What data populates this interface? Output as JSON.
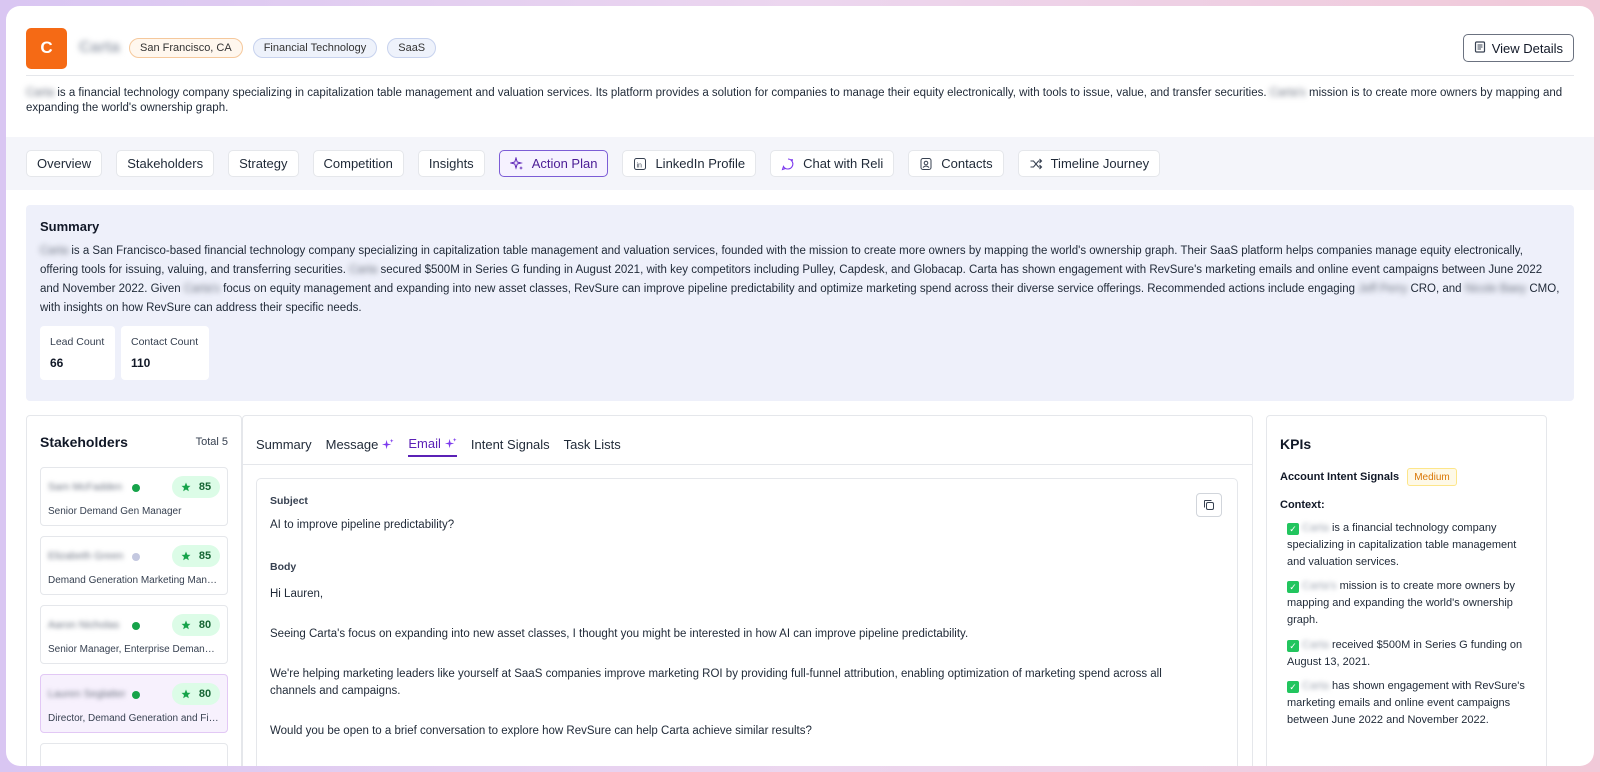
{
  "company": {
    "logo_letter": "C",
    "name": "Carta",
    "tags": [
      "San Francisco, CA",
      "Financial Technology",
      "SaaS"
    ],
    "view_details": "View Details",
    "description_name": "Carta",
    "description_a": "is a financial technology company specializing in capitalization table management and valuation services. Its platform provides a solution for companies to manage their equity electronically, with tools to issue, value, and transfer securities.",
    "description_name2": "Carta's",
    "description_b": "mission is to create more owners by mapping and expanding the world's ownership graph."
  },
  "tabs": [
    {
      "label": "Overview",
      "icon": ""
    },
    {
      "label": "Stakeholders",
      "icon": ""
    },
    {
      "label": "Strategy",
      "icon": ""
    },
    {
      "label": "Competition",
      "icon": ""
    },
    {
      "label": "Insights",
      "icon": ""
    },
    {
      "label": "Action Plan",
      "icon": "sparkle-icon"
    },
    {
      "label": "LinkedIn Profile",
      "icon": "linkedin-icon"
    },
    {
      "label": "Chat with Reli",
      "icon": "chat-icon"
    },
    {
      "label": "Contacts",
      "icon": "contacts-icon"
    },
    {
      "label": "Timeline Journey",
      "icon": "shuffle-icon"
    }
  ],
  "summary": {
    "title": "Summary",
    "p1_name": "Carta",
    "p1": "is a San Francisco-based financial technology company specializing in capitalization table management and valuation services, founded with the mission to create more owners by mapping the world's ownership graph. Their SaaS platform helps companies manage equity electronically, offering tools for issuing, valuing, and transferring securities.",
    "p2_name": "Carta",
    "p2": "secured $500M in Series G funding in August 2021, with key competitors including Pulley, Capdesk, and Globacap. Carta has shown engagement with RevSure's marketing emails and online event campaigns between June 2022 and November 2022. Given",
    "p3_name": "Carta's",
    "p3": "focus on equity management and expanding into new asset classes, RevSure can improve pipeline predictability and optimize marketing spend across their diverse service offerings. Recommended actions include engaging",
    "p4_name": "Jeff Perry",
    "p4": "CRO, and",
    "p5_name": "Nicole Baey",
    "p5": "CMO, with insights on how RevSure can address their specific needs.",
    "lead_label": "Lead Count",
    "lead_value": "66",
    "contact_label": "Contact Count",
    "contact_value": "110"
  },
  "stakeholders": {
    "title": "Stakeholders",
    "total": "Total 5",
    "items": [
      {
        "name": "Sam McFadden",
        "role": "Senior Demand Gen Manager",
        "score": "85",
        "dot": "#16a34a"
      },
      {
        "name": "Elizabeth Green",
        "role": "Demand Generation Marketing Manager",
        "score": "85",
        "dot": "#c4c8e0"
      },
      {
        "name": "Aaron Nicholas",
        "role": "Senior Manager, Enterprise Demand Generation",
        "score": "80",
        "dot": "#16a34a"
      },
      {
        "name": "Lauren Seglatter",
        "role": "Director, Demand Generation and Field Marketing",
        "score": "80",
        "dot": "#16a34a"
      }
    ]
  },
  "action": {
    "subtabs": [
      {
        "label": "Summary",
        "sparkle": false
      },
      {
        "label": "Message",
        "sparkle": true
      },
      {
        "label": "Email",
        "sparkle": true
      },
      {
        "label": "Intent Signals",
        "sparkle": false
      },
      {
        "label": "Task Lists",
        "sparkle": false
      }
    ],
    "subject_label": "Subject",
    "subject": "AI to improve pipeline predictability?",
    "body_label": "Body",
    "greeting": "Hi Lauren,",
    "para1": "Seeing Carta's focus on expanding into new asset classes, I thought you might be interested in how AI can improve pipeline predictability.",
    "para2": "We're helping marketing leaders like yourself at SaaS companies improve marketing ROI by providing full-funnel attribution, enabling optimization of marketing spend across all channels and campaigns.",
    "para3": "Would you be open to a brief conversation to explore how RevSure can help Carta achieve similar results?"
  },
  "kpis": {
    "title": "KPIs",
    "intent_label": "Account Intent Signals",
    "intent_badge": "Medium",
    "context_label": "Context:",
    "items": [
      {
        "name": "Carta",
        "text": "is a financial technology company specializing in capitalization table management and valuation services."
      },
      {
        "name": "Carta's",
        "text": "mission is to create more owners by mapping and expanding the world's ownership graph."
      },
      {
        "name": "Carta",
        "text": "received $500M in Series G funding on August 13, 2021."
      },
      {
        "name": "Carta",
        "text": "has shown engagement with RevSure's marketing emails and online event campaigns between June 2022 and November 2022."
      }
    ]
  },
  "colors": {
    "accent": "#5b21b6",
    "logo": "#f56a15",
    "score_bg": "#dcfce7",
    "status_green": "#16a34a"
  }
}
